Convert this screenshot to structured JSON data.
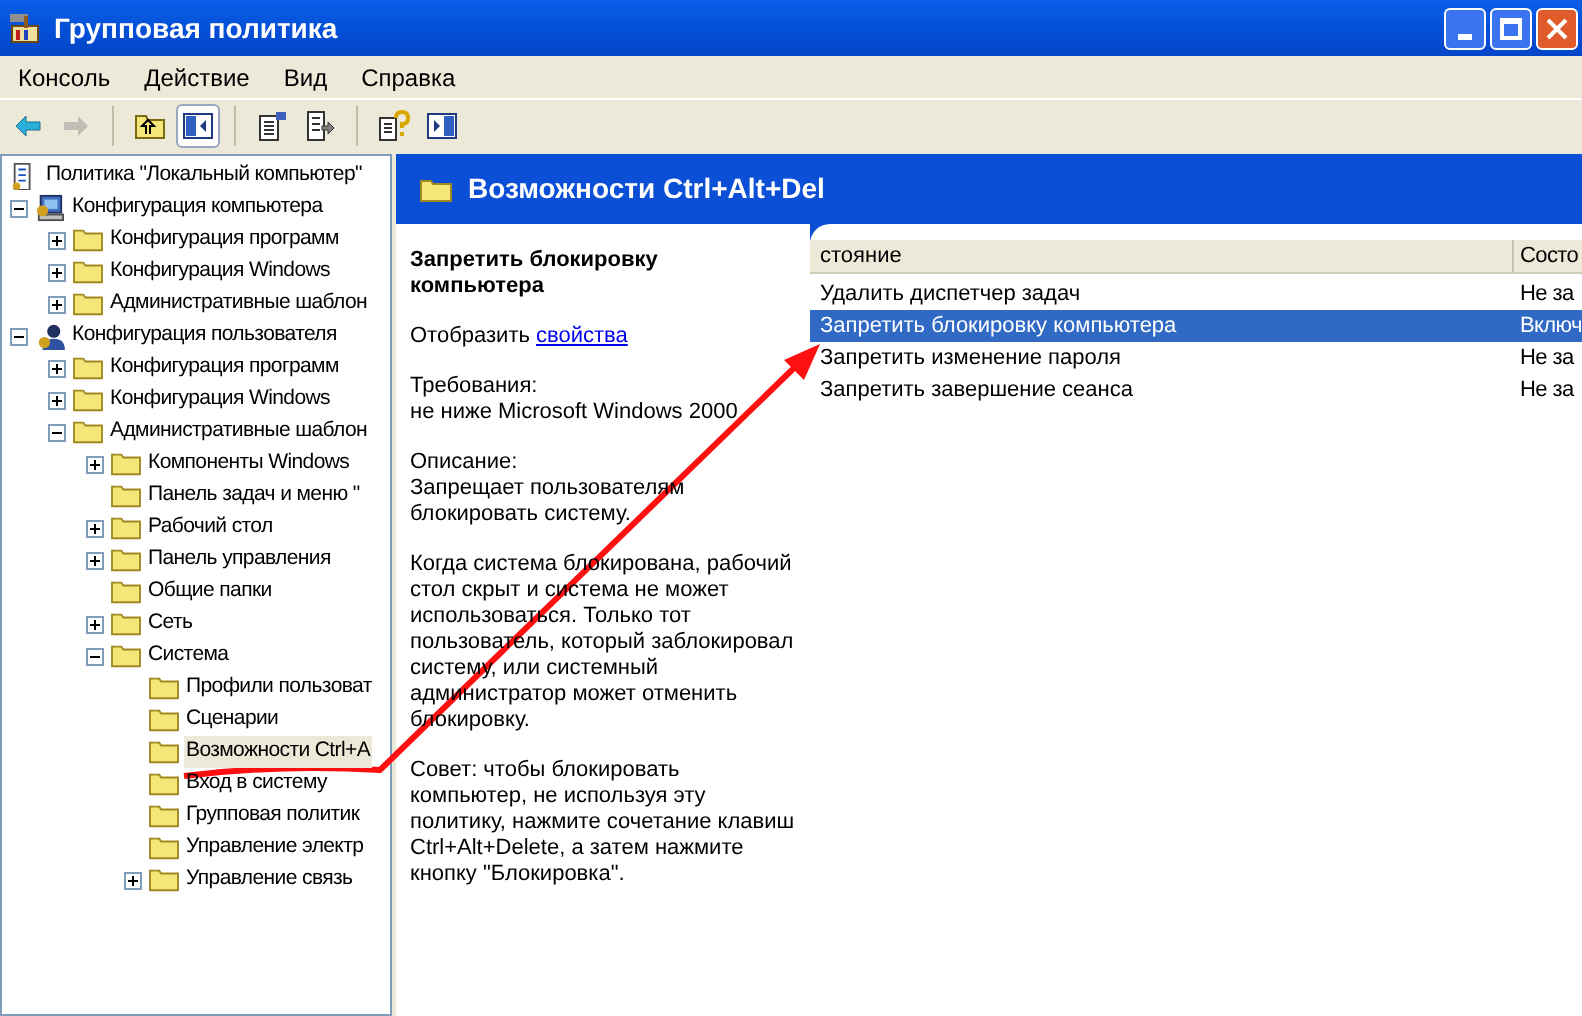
{
  "window": {
    "title": "Групповая политика"
  },
  "menu": [
    "Консоль",
    "Действие",
    "Вид",
    "Справка"
  ],
  "toolbar": [
    {
      "kind": "back",
      "disabled": false,
      "pressed": false
    },
    {
      "kind": "forward",
      "disabled": true,
      "pressed": false
    },
    {
      "kind": "separator"
    },
    {
      "kind": "up",
      "disabled": false,
      "pressed": false
    },
    {
      "kind": "tree",
      "disabled": false,
      "pressed": true
    },
    {
      "kind": "separator"
    },
    {
      "kind": "properties",
      "disabled": false,
      "pressed": false
    },
    {
      "kind": "export",
      "disabled": false,
      "pressed": false
    },
    {
      "kind": "separator"
    },
    {
      "kind": "help",
      "disabled": false,
      "pressed": false
    },
    {
      "kind": "pane",
      "disabled": false,
      "pressed": false
    }
  ],
  "tree": [
    {
      "label": "Политика \"Локальный компьютер\"",
      "kind": "root",
      "selected": false,
      "children": [
        {
          "label": "Конфигурация компьютера",
          "kind": "expandable",
          "expanded": true,
          "selected": false,
          "children": [
            {
              "label": "Конфигурация программ",
              "kind": "expandable",
              "expanded": false,
              "selected": false
            },
            {
              "label": "Конфигурация Windows",
              "kind": "expandable",
              "expanded": false,
              "selected": false
            },
            {
              "label": "Административные шаблон",
              "kind": "expandable",
              "expanded": false,
              "selected": false
            }
          ]
        },
        {
          "label": "Конфигурация пользователя",
          "kind": "expandable",
          "expanded": true,
          "selected": false,
          "children": [
            {
              "label": "Конфигурация программ",
              "kind": "expandable",
              "expanded": false,
              "selected": false
            },
            {
              "label": "Конфигурация Windows",
              "kind": "expandable",
              "expanded": false,
              "selected": false
            },
            {
              "label": "Административные шаблон",
              "kind": "expandable",
              "expanded": true,
              "selected": false,
              "children": [
                {
                  "label": "Компоненты Windows",
                  "kind": "expandable",
                  "expanded": false,
                  "selected": false
                },
                {
                  "label": "Панель задач и меню \"",
                  "kind": "leaf",
                  "selected": false
                },
                {
                  "label": "Рабочий стол",
                  "kind": "expandable",
                  "expanded": false,
                  "selected": false
                },
                {
                  "label": "Панель управления",
                  "kind": "expandable",
                  "expanded": false,
                  "selected": false
                },
                {
                  "label": "Общие папки",
                  "kind": "leaf",
                  "selected": false
                },
                {
                  "label": "Сеть",
                  "kind": "expandable",
                  "expanded": false,
                  "selected": false
                },
                {
                  "label": "Система",
                  "kind": "expandable",
                  "expanded": true,
                  "selected": false,
                  "children": [
                    {
                      "label": "Профили пользоват",
                      "kind": "leaf",
                      "selected": false
                    },
                    {
                      "label": "Сценарии",
                      "kind": "leaf",
                      "selected": false
                    },
                    {
                      "label": "Возможности Ctrl+A",
                      "kind": "leaf",
                      "selected": true
                    },
                    {
                      "label": "Вход в систему",
                      "kind": "leaf",
                      "selected": false
                    },
                    {
                      "label": "Групповая политик",
                      "kind": "leaf",
                      "selected": false
                    },
                    {
                      "label": "Управление электр",
                      "kind": "leaf",
                      "selected": false
                    },
                    {
                      "label": "Управление связь",
                      "kind": "expandable",
                      "expanded": false,
                      "selected": false
                    }
                  ]
                }
              ]
            }
          ]
        }
      ]
    }
  ],
  "header": {
    "title": "Возможности Ctrl+Alt+Del"
  },
  "description": {
    "title": "Запретить блокировку компьютера",
    "show_prefix": "Отобразить",
    "link": "свойства",
    "paragraphs": [
      "Требования:\nне ниже Microsoft Windows 2000",
      "Описание:\nЗапрещает пользователям блокировать систему.",
      "Когда система блокирована, рабочий стол скрыт и система не может использоваться. Только тот пользователь, который заблокировал систему, или системный администратор может отменить блокировку.",
      "Совет: чтобы блокировать компьютер, не используя эту политику, нажмите сочетание клавиш Ctrl+Alt+Delete, а затем нажмите кнопку \"Блокировка\"."
    ]
  },
  "list": {
    "columns": [
      "стояние",
      "Состо"
    ],
    "rows": [
      {
        "name": "Удалить диспетчер задач",
        "state": "Не за",
        "selected": false
      },
      {
        "name": "Запретить блокировку компьютера",
        "state": "Включ",
        "selected": true
      },
      {
        "name": "Запретить изменение пароля",
        "state": "Не за",
        "selected": false
      },
      {
        "name": "Запретить завершение сеанса",
        "state": "Не за",
        "selected": false
      }
    ]
  }
}
